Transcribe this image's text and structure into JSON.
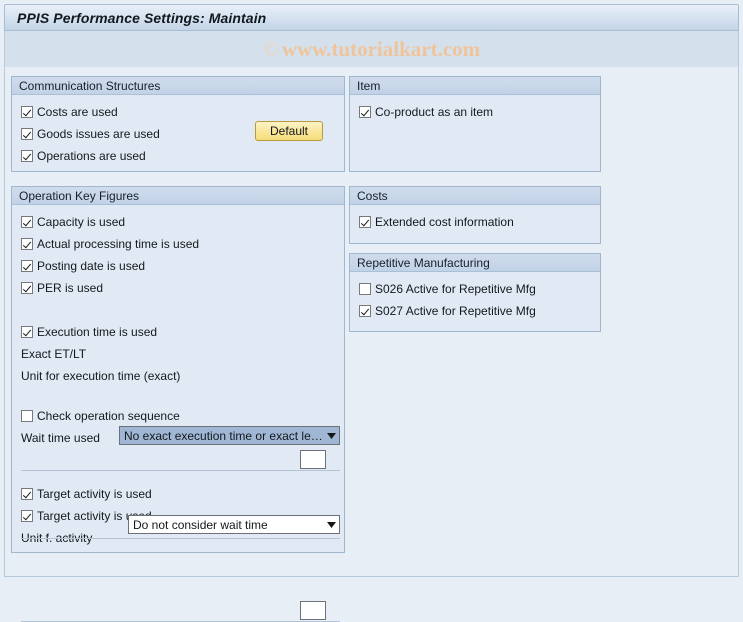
{
  "window": {
    "title": "PPIS Performance Settings: Maintain"
  },
  "watermark": {
    "copyright_symbol": "©",
    "text": "www.tutorialkart.com"
  },
  "groups": {
    "communication_structures": {
      "header": "Communication Structures",
      "checkboxes": [
        {
          "label": "Costs are used",
          "checked": true
        },
        {
          "label": "Goods issues are used",
          "checked": true
        },
        {
          "label": "Operations are used",
          "checked": true
        }
      ],
      "default_button": "Default"
    },
    "operation_key_figures": {
      "header": "Operation Key Figures",
      "checkboxes_top": [
        {
          "label": "Capacity is used",
          "checked": true
        },
        {
          "label": "Actual processing time is used",
          "checked": true
        },
        {
          "label": "Posting date is used",
          "checked": true
        },
        {
          "label": "PER is used",
          "checked": true
        }
      ],
      "execution_time": {
        "label": "Execution time is used",
        "checked": true
      },
      "exact_et_lt": {
        "label": "Exact ET/LT",
        "value": "No exact execution time or exact le…"
      },
      "unit_execution_time": {
        "label": "Unit for execution time (exact)",
        "value": ""
      },
      "check_operation_sequence": {
        "label": "Check operation sequence",
        "checked": false
      },
      "wait_time": {
        "label": "Wait time used",
        "value": "Do not consider wait time"
      },
      "target_activity_1": {
        "label": "Target activity is used",
        "checked": true
      },
      "target_activity_2": {
        "label": "Target activity is used",
        "checked": true
      },
      "unit_activity": {
        "label": "Unit f. activity",
        "value": ""
      }
    },
    "item": {
      "header": "Item",
      "checkboxes": [
        {
          "label": "Co-product as an item",
          "checked": true
        }
      ]
    },
    "costs": {
      "header": "Costs",
      "checkboxes": [
        {
          "label": "Extended cost information",
          "checked": true
        }
      ]
    },
    "repetitive_manufacturing": {
      "header": "Repetitive Manufacturing",
      "checkboxes": [
        {
          "label": "S026 Active for Repetitive Mfg",
          "checked": false
        },
        {
          "label": "S027 Active for Repetitive Mfg",
          "checked": true
        }
      ]
    }
  },
  "colors": {
    "background": "#e8eef6",
    "group_bg": "#e1eaf4",
    "group_header": "#c6d5e8",
    "title_bar": "#cddcec",
    "watermark": "#f0c49a",
    "button_yellow": "#f9e79a",
    "combo_selected": "#9fb7d4"
  }
}
